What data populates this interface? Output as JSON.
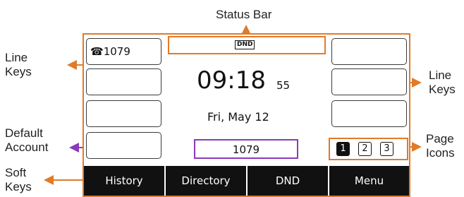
{
  "callouts": {
    "status_bar": "Status Bar",
    "line_keys_left": [
      "Line",
      "Keys"
    ],
    "line_keys_right": [
      "Line",
      "Keys"
    ],
    "default_account": [
      "Default",
      "Account"
    ],
    "page_icons": [
      "Page",
      "Icons"
    ],
    "soft_keys": [
      "Soft",
      "Keys"
    ]
  },
  "screen": {
    "line_key_1": "1079",
    "status_icon": "DND",
    "time_main": "09:18",
    "time_seconds": "55",
    "date": "Fri, May 12",
    "default_account": "1079",
    "pages": [
      "1",
      "2",
      "3"
    ],
    "soft_keys": [
      "History",
      "Directory",
      "DND",
      "Menu"
    ]
  },
  "colors": {
    "callout_accent": "#e07b2a",
    "account_accent": "#8a3ab9",
    "softkey_bg": "#111111"
  },
  "icons": {
    "line_key_1": "phone-icon"
  }
}
